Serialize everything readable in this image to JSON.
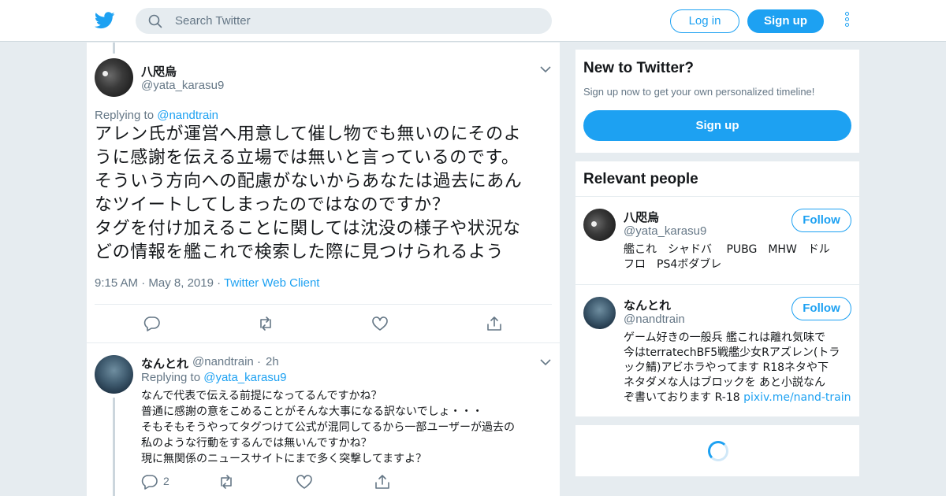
{
  "colors": {
    "accent": "#1da1f2",
    "background": "#e6ecf0",
    "text": "#14171a",
    "muted": "#657786"
  },
  "header": {
    "logo_icon": "twitter-bird-icon",
    "search_placeholder": "Search Twitter",
    "login_label": "Log in",
    "signup_label": "Sign up",
    "more_icon": "vertical-dots-icon"
  },
  "tweet": {
    "author_name": "八咫烏",
    "author_handle": "@yata_karasu9",
    "replying_prefix": "Replying to",
    "replying_to": "@nandtrain",
    "text_lines": [
      "アレン氏が運営へ用意して催し物でも無いのにそのよ",
      "うに感謝を伝える立場では無いと言っているのです。",
      "そういう方向への配慮がないからあなたは過去にあん",
      "なツイートしてしまったのではなのですか？",
      "タグを付け加えることに関しては沈没の様子や状況な",
      "どの情報を艦これで検索した際に見つけられるよう"
    ],
    "time": "9:15 AM",
    "date": "May 8, 2019",
    "client": "Twitter Web Client"
  },
  "reply": {
    "author_name": "なんとれ",
    "author_handle": "@nandtrain",
    "age": "2h",
    "replying_prefix": "Replying to",
    "replying_to": "@yata_karasu9",
    "text_lines": [
      "なんで代表で伝える前提になってるんですかね？",
      "普通に感謝の意をこめることがそんな大事になる訳ないでしょ・・・",
      "そもそもそうやってタグつけて公式が混同してるから一部ユーザーが過去の",
      "私のような行動をするんでは無いんですかね？",
      "現に無関係のニュースサイトにまで多く突撃してますよ？"
    ],
    "reply_count": "2"
  },
  "sidebar": {
    "new_title": "New to Twitter?",
    "new_sub": "Sign up now to get your own personalized timeline!",
    "new_signup_label": "Sign up",
    "relevant_title": "Relevant people",
    "people": [
      {
        "name": "八咫烏",
        "handle": "@yata_karasu9",
        "follow_label": "Follow",
        "bio_lines": [
          "艦これ　シャドバ　 PUBG　MHW　ドル",
          "フロ　PS4ボダブレ"
        ]
      },
      {
        "name": "なんとれ",
        "handle": "@nandtrain",
        "follow_label": "Follow",
        "bio_lines": [
          "ゲーム好きの一般兵 艦これは離れ気味で",
          "今はterratechBF5戦艦少女Rアズレン(トラ",
          "ック鯖)アビホラやってます R18ネタや下",
          "ネタダメな人はブロックを あと小説なん"
        ],
        "bio_last_prefix": "ぞ書いております R-18 ",
        "bio_link": "pixiv.me/nand-train"
      }
    ]
  }
}
